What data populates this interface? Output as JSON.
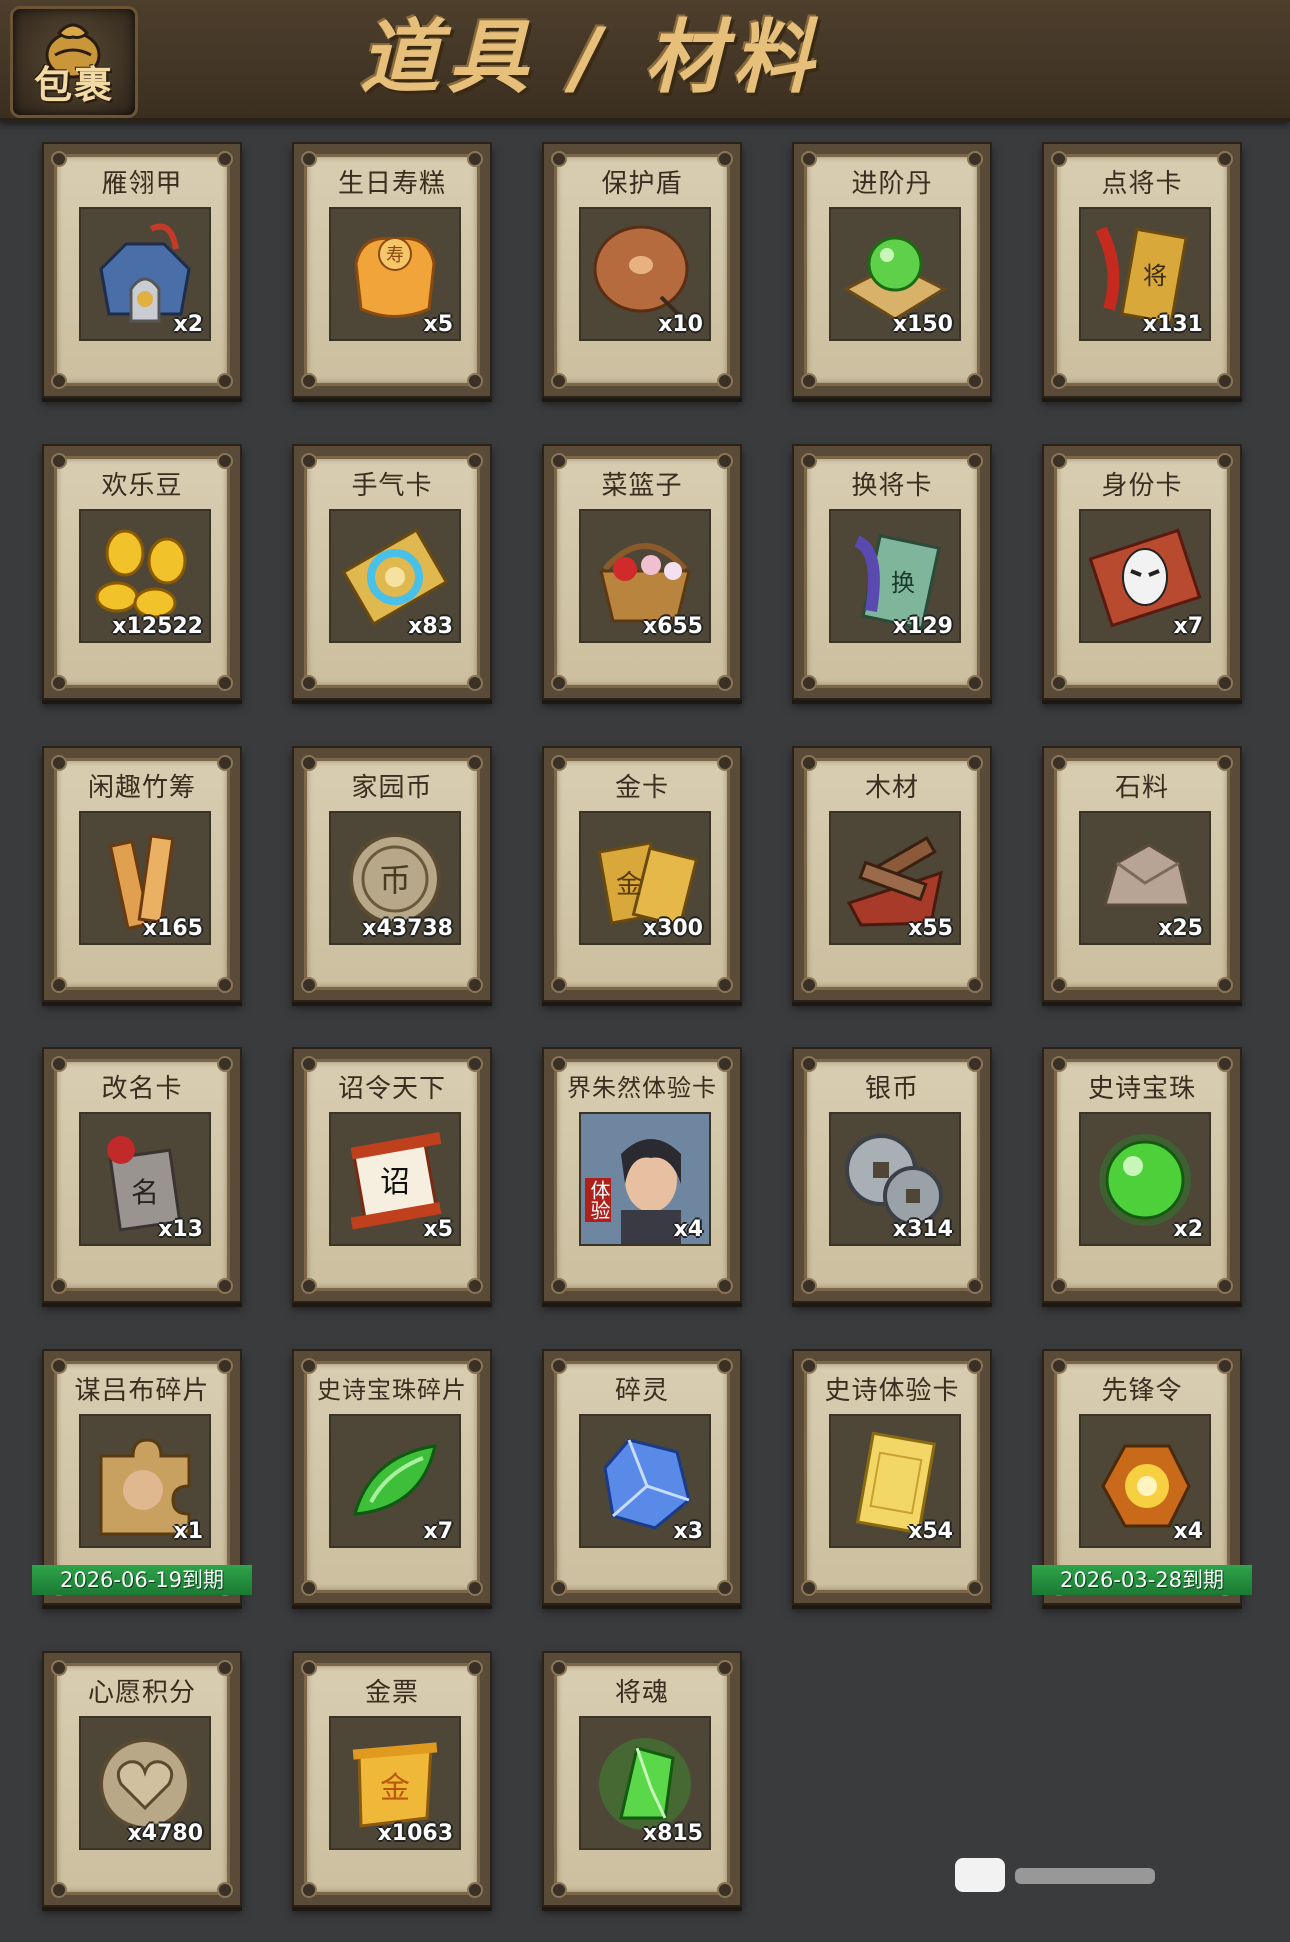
{
  "header": {
    "bag_label": "包裹",
    "title": "道具 / 材料"
  },
  "items": [
    {
      "name": "雁翎甲",
      "qty": "x2",
      "icon": "armor-icon"
    },
    {
      "name": "生日寿糕",
      "qty": "x5",
      "icon": "birthday-cake-icon"
    },
    {
      "name": "保护盾",
      "qty": "x10",
      "icon": "shield-icon"
    },
    {
      "name": "进阶丹",
      "qty": "x150",
      "icon": "pill-icon"
    },
    {
      "name": "点将卡",
      "qty": "x131",
      "icon": "general-card-icon"
    },
    {
      "name": "欢乐豆",
      "qty": "x12522",
      "icon": "beans-icon"
    },
    {
      "name": "手气卡",
      "qty": "x83",
      "icon": "luck-card-icon"
    },
    {
      "name": "菜篮子",
      "qty": "x655",
      "icon": "basket-icon"
    },
    {
      "name": "换将卡",
      "qty": "x129",
      "icon": "swap-card-icon"
    },
    {
      "name": "身份卡",
      "qty": "x7",
      "icon": "identity-card-icon"
    },
    {
      "name": "闲趣竹筹",
      "qty": "x165",
      "icon": "bamboo-tally-icon"
    },
    {
      "name": "家园币",
      "qty": "x43738",
      "icon": "home-coin-icon"
    },
    {
      "name": "金卡",
      "qty": "x300",
      "icon": "gold-card-icon"
    },
    {
      "name": "木材",
      "qty": "x55",
      "icon": "wood-icon"
    },
    {
      "name": "石料",
      "qty": "x25",
      "icon": "stone-icon"
    },
    {
      "name": "改名卡",
      "qty": "x13",
      "icon": "rename-card-icon"
    },
    {
      "name": "诏令天下",
      "qty": "x5",
      "icon": "edict-scroll-icon"
    },
    {
      "name": "界朱然体验卡",
      "qty": "x4",
      "icon": "hero-portrait-icon",
      "badge": "体验"
    },
    {
      "name": "银币",
      "qty": "x314",
      "icon": "silver-coin-icon"
    },
    {
      "name": "史诗宝珠",
      "qty": "x2",
      "icon": "epic-orb-icon"
    },
    {
      "name": "谋吕布碎片",
      "qty": "x1",
      "icon": "puzzle-piece-icon",
      "expiry": "2026-06-19到期"
    },
    {
      "name": "史诗宝珠碎片",
      "qty": "x7",
      "icon": "orb-shard-icon"
    },
    {
      "name": "碎灵",
      "qty": "x3",
      "icon": "crystal-icon"
    },
    {
      "name": "史诗体验卡",
      "qty": "x54",
      "icon": "epic-trial-card-icon"
    },
    {
      "name": "先锋令",
      "qty": "x4",
      "icon": "vanguard-token-icon",
      "expiry": "2026-03-28到期"
    },
    {
      "name": "心愿积分",
      "qty": "x4780",
      "icon": "heart-coin-icon"
    },
    {
      "name": "金票",
      "qty": "x1063",
      "icon": "gold-ticket-icon"
    },
    {
      "name": "将魂",
      "qty": "x815",
      "icon": "soul-crystal-icon"
    }
  ],
  "colors": {
    "background": "#3a3b3d",
    "card_face": "#d3c8aa",
    "title_gold": "#e6c07a",
    "expiry_green": "#1b7a33"
  }
}
